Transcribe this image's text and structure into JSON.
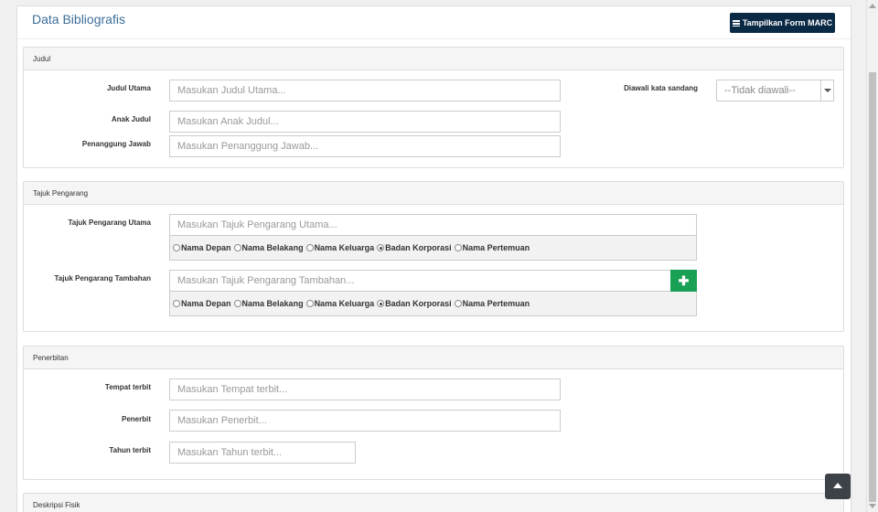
{
  "page": {
    "title": "Data Bibliografis",
    "marc_button": "Tampilkan Form MARC"
  },
  "judul": {
    "heading": "Judul",
    "judul_utama": {
      "label": "Judul Utama",
      "placeholder": "Masukan Judul Utama..."
    },
    "diawali": {
      "label": "Diawali kata sandang",
      "value": "--Tidak diawali--"
    },
    "anak_judul": {
      "label": "Anak Judul",
      "placeholder": "Masukan Anak Judul..."
    },
    "penanggung_jawab": {
      "label": "Penanggung Jawab",
      "placeholder": "Masukan Penanggung Jawab..."
    }
  },
  "tajuk": {
    "heading": "Tajuk Pengarang",
    "utama": {
      "label": "Tajuk Pengarang Utama",
      "placeholder": "Masukan Tajuk Pengarang Utama...",
      "options": [
        "Nama Depan",
        "Nama Belakang",
        "Nama Keluarga",
        "Badan Korporasi",
        "Nama Pertemuan"
      ],
      "selected": "Badan Korporasi"
    },
    "tambahan": {
      "label": "Tajuk Pengarang Tambahan",
      "placeholder": "Masukan Tajuk Pengarang Tambahan...",
      "options": [
        "Nama Depan",
        "Nama Belakang",
        "Nama Keluarga",
        "Badan Korporasi",
        "Nama Pertemuan"
      ],
      "selected": "Badan Korporasi",
      "add_icon": "plus-icon"
    }
  },
  "penerbitan": {
    "heading": "Penerbitan",
    "tempat": {
      "label": "Tempat terbit",
      "placeholder": "Masukan Tempat terbit..."
    },
    "penerbit": {
      "label": "Penerbit",
      "placeholder": "Masukan Penerbit..."
    },
    "tahun": {
      "label": "Tahun terbit",
      "placeholder": "Masukan Tahun terbit..."
    }
  },
  "deskripsi": {
    "heading": "Deskripsi Fisik"
  },
  "icons": {
    "marc": "grid-icon",
    "scroll_top": "chevron-up-icon"
  }
}
